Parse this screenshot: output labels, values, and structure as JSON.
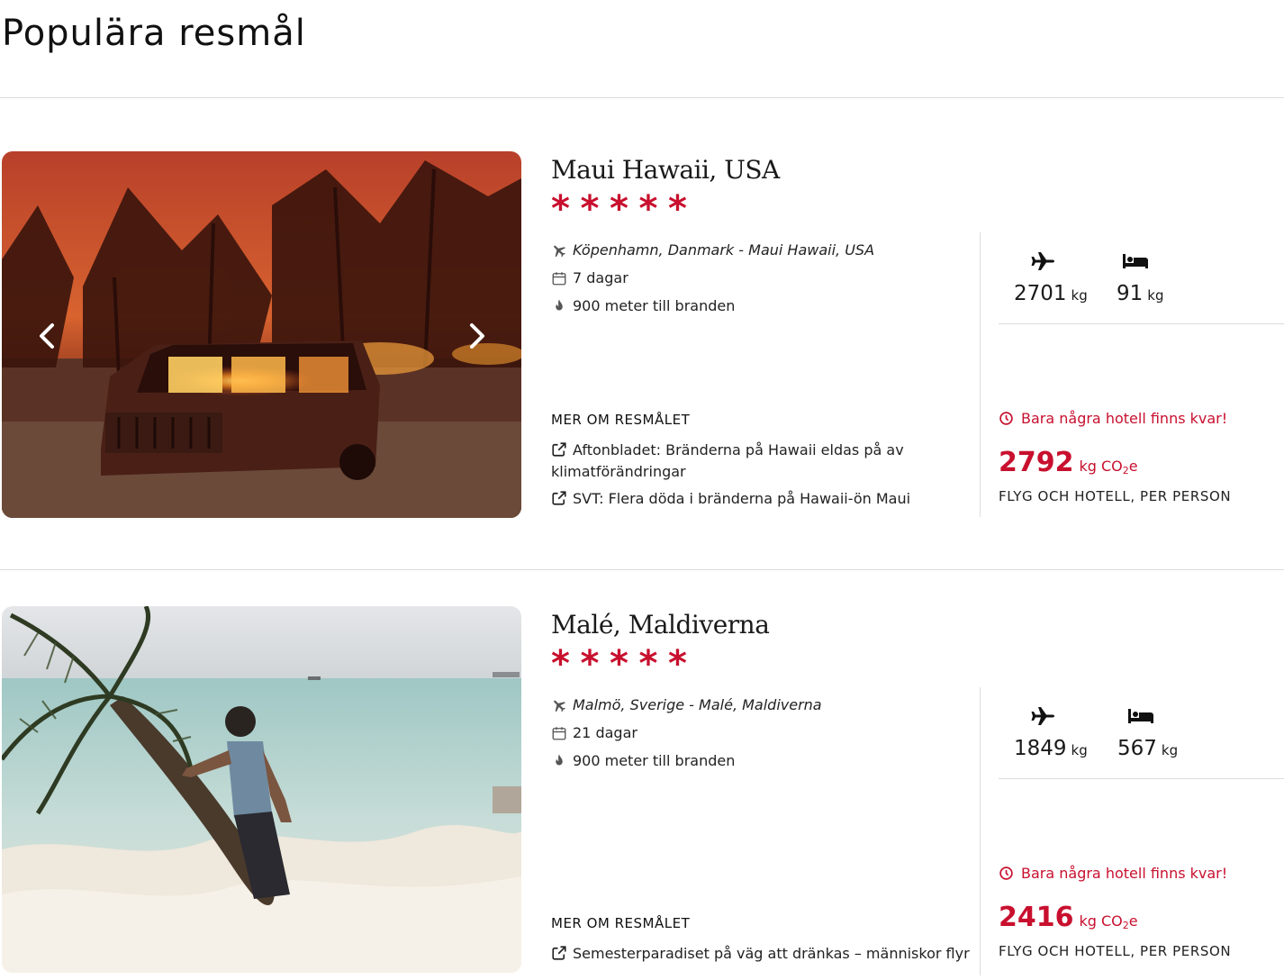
{
  "page_title": "Populära resmål",
  "destinations": [
    {
      "title": "Maui Hawaii, USA",
      "stars": [
        "*",
        "*",
        "*",
        "*",
        "*"
      ],
      "route": "Köpenhamn, Danmark - Maui Hawaii, USA",
      "duration": "7 dagar",
      "fire_distance": "900 meter till branden",
      "more_title": "MER OM RESMÅLET",
      "links": [
        "Aftonbladet: Bränderna på Hawaii eldas på av klimatförändringar",
        "SVT: Flera döda i bränderna på Hawaii-ön Maui"
      ],
      "flight_emission": "2701",
      "hotel_emission": "91",
      "emission_unit": "kg",
      "warning": "Bara några hotell finns kvar!",
      "total_emission": "2792",
      "total_unit_prefix": "kg CO",
      "total_unit_sub": "2",
      "total_unit_suffix": "e",
      "total_caption": "FLYG OCH HOTELL, PER PERSON"
    },
    {
      "title": "Malé, Maldiverna",
      "stars": [
        "*",
        "*",
        "*",
        "*",
        "*"
      ],
      "route": "Malmö, Sverige - Malé, Maldiverna",
      "duration": "21 dagar",
      "fire_distance": "900 meter till branden",
      "more_title": "MER OM RESMÅLET",
      "links": [
        "Semesterparadiset på väg att dränkas – människor flyr"
      ],
      "flight_emission": "1849",
      "hotel_emission": "567",
      "emission_unit": "kg",
      "warning": "Bara några hotell finns kvar!",
      "total_emission": "2416",
      "total_unit_prefix": "kg CO",
      "total_unit_sub": "2",
      "total_unit_suffix": "e",
      "total_caption": "FLYG OCH HOTELL, PER PERSON"
    }
  ],
  "colors": {
    "accent_red": "#c8102e",
    "divider": "#dcdcdc"
  },
  "icons": [
    "plane-icon",
    "calendar-icon",
    "fire-icon",
    "external-link-icon",
    "bed-icon",
    "clock-icon",
    "chevron-left-icon",
    "chevron-right-icon"
  ]
}
